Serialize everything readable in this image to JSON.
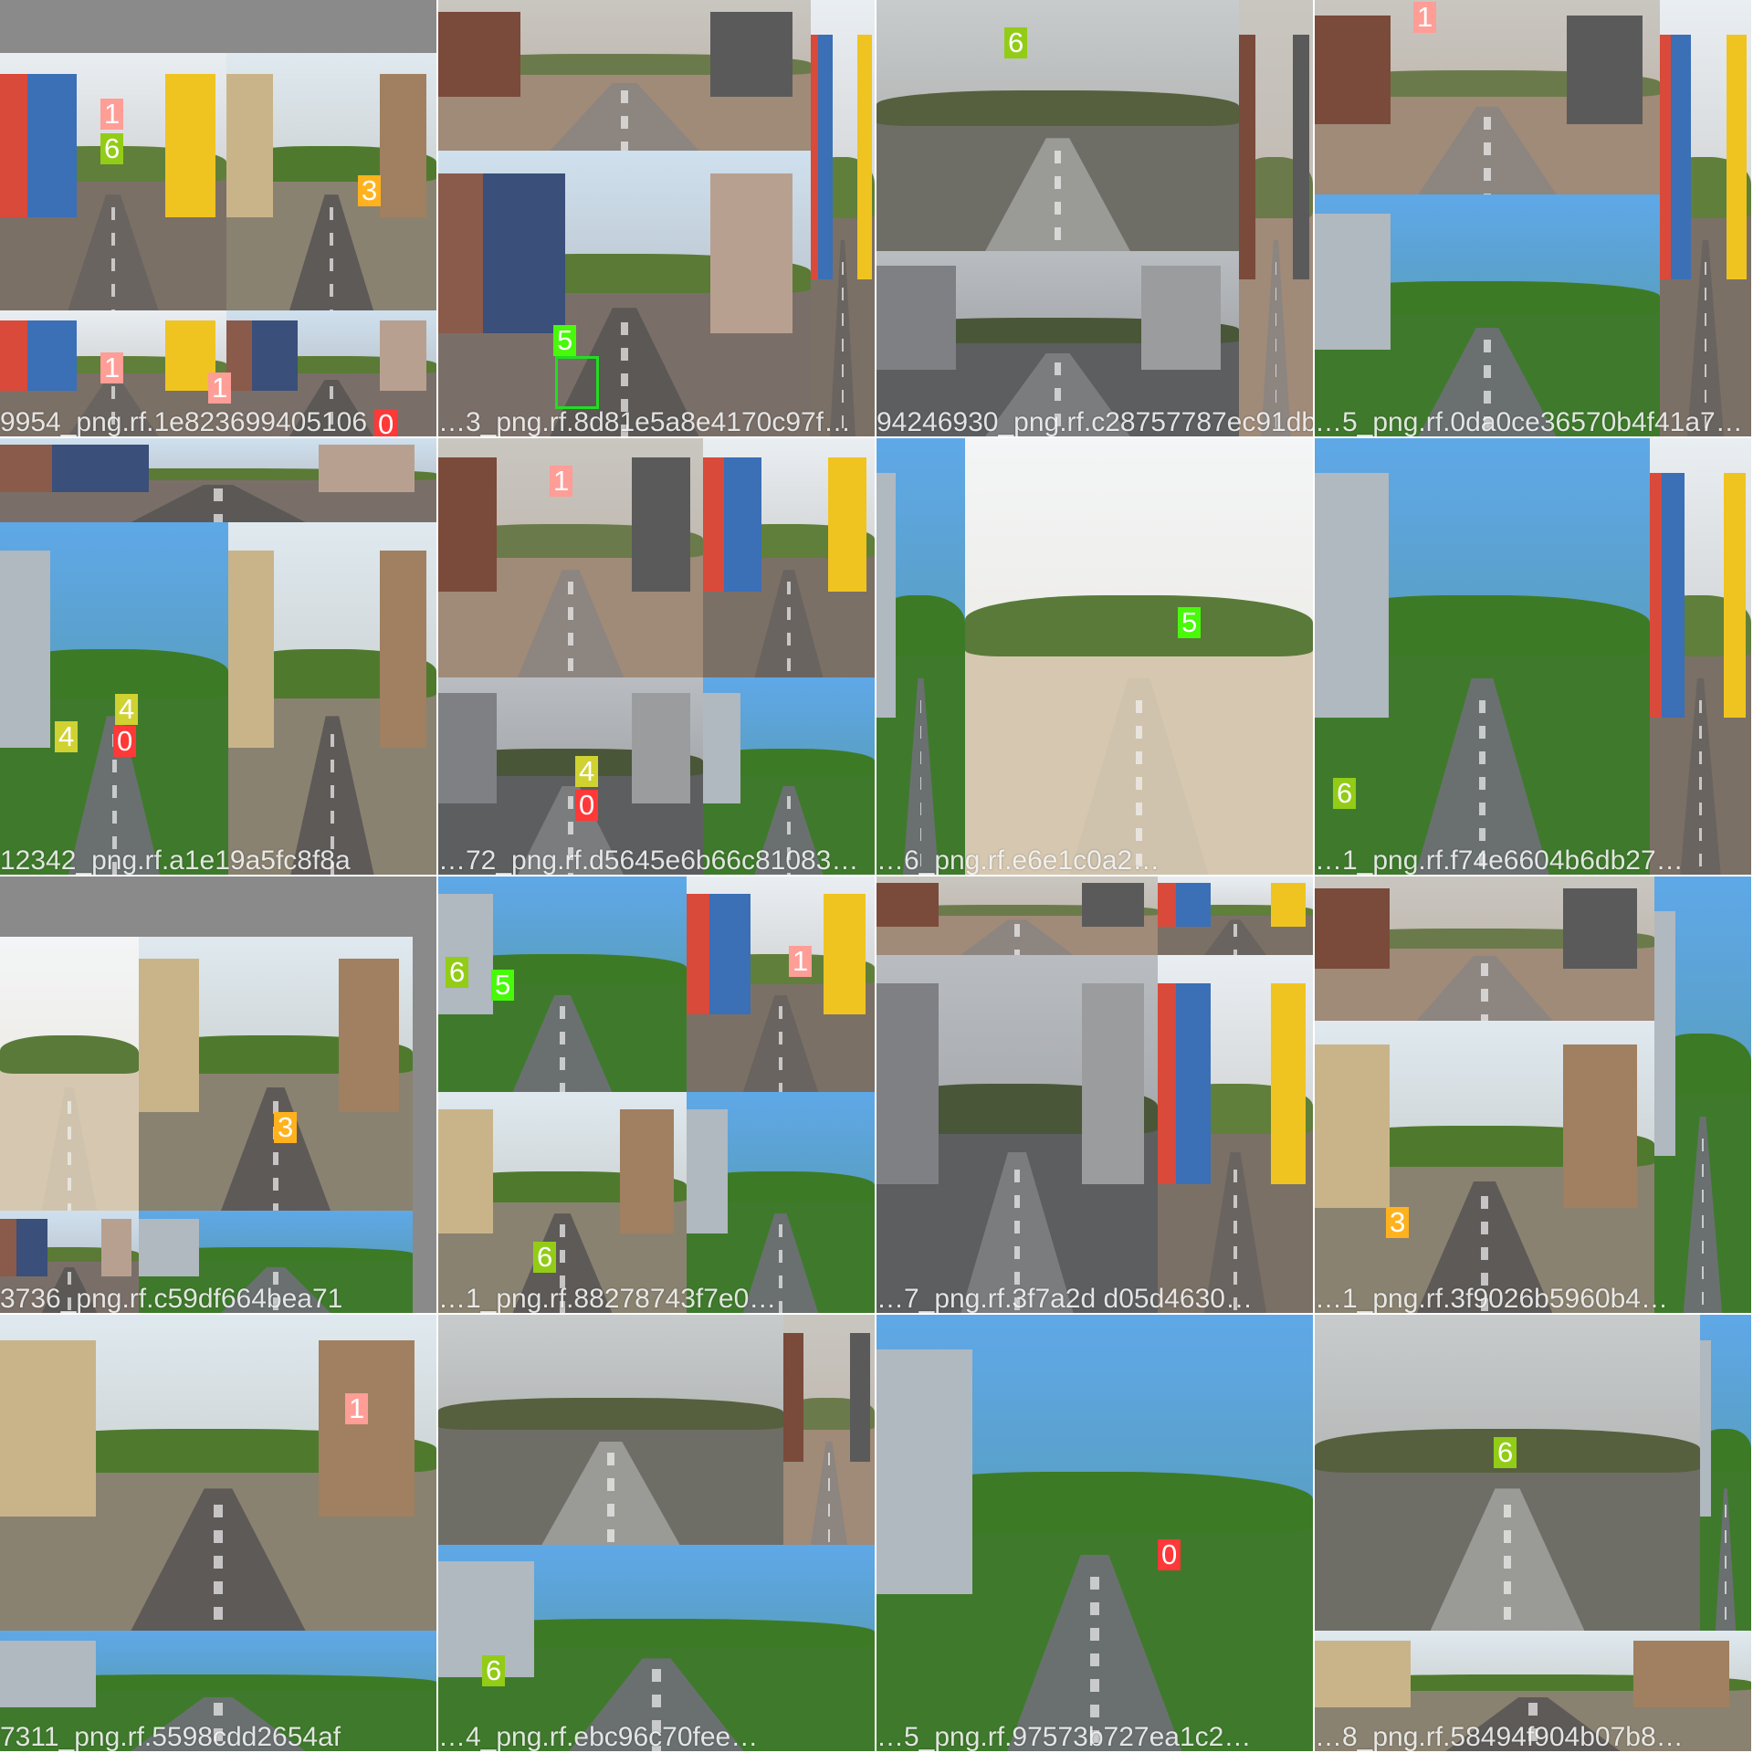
{
  "class_colors": {
    "0": "#ff3838",
    "1": "#ff9d97",
    "3": "#ffb21d",
    "4": "#cfd231",
    "5": "#48f90a",
    "6": "#92cc17"
  },
  "cells": [
    {
      "caption": "9954_png.rf.1e823699405106",
      "tiles": [
        {
          "scene": "street-shops"
        },
        {
          "scene": "street-trees"
        },
        {
          "scene": "street-shops"
        },
        {
          "scene": "street-city"
        }
      ],
      "labels": [
        "1",
        "6",
        "3",
        "1",
        "1",
        "0"
      ]
    },
    {
      "caption": "…3_png.rf.8d81e5a8e4170c97f…",
      "tiles": [
        {
          "scene": "street-motorbikes"
        },
        {
          "scene": "street-city"
        },
        {
          "scene": "street-shops"
        }
      ],
      "labels": [
        "5"
      ]
    },
    {
      "caption": "94246930_png.rf.c28757787ec91db…",
      "tiles": [
        {
          "scene": "highway"
        },
        {
          "scene": "overpass"
        },
        {
          "scene": "street-motorbikes"
        }
      ],
      "labels": [
        "6"
      ]
    },
    {
      "caption": "…5_png.rf.0da0ce36570b4f41a7…",
      "tiles": [
        {
          "scene": "street-motorbikes"
        },
        {
          "scene": "sky-trees"
        },
        {
          "scene": "street-shops"
        }
      ],
      "labels": [
        "1"
      ]
    },
    {
      "caption": "12342_png.rf.a1e19a5fc8f8a",
      "tiles": [
        {
          "scene": "street-city"
        },
        {
          "scene": "sky-trees"
        },
        {
          "scene": "street-trees"
        }
      ],
      "labels": [
        "4",
        "4",
        "0"
      ]
    },
    {
      "caption": "…72_png.rf.d5645e6b66c81083…",
      "tiles": [
        {
          "scene": "street-motorbikes"
        },
        {
          "scene": "street-shops"
        },
        {
          "scene": "overpass"
        },
        {
          "scene": "sky-trees"
        }
      ],
      "labels": [
        "1",
        "4",
        "0"
      ]
    },
    {
      "caption": "…6_png.rf.e6e1c0a2…",
      "tiles": [
        {
          "scene": "sky-trees"
        },
        {
          "scene": "open-road"
        }
      ],
      "labels": [
        "5"
      ]
    },
    {
      "caption": "…1_png.rf.f74e6604b6db27…",
      "tiles": [
        {
          "scene": "sky-trees"
        },
        {
          "scene": "street-shops"
        }
      ],
      "labels": [
        "6"
      ]
    },
    {
      "caption": "3736_png.rf.c59df664bea71",
      "tiles": [
        {
          "scene": "open-road"
        },
        {
          "scene": "street-trees"
        },
        {
          "scene": "street-city"
        },
        {
          "scene": "sky-trees"
        }
      ],
      "labels": [
        "3"
      ]
    },
    {
      "caption": "…1_png.rf.88278743f7e0…",
      "tiles": [
        {
          "scene": "sky-trees"
        },
        {
          "scene": "street-shops"
        },
        {
          "scene": "street-trees"
        },
        {
          "scene": "sky-trees"
        }
      ],
      "labels": [
        "6",
        "5",
        "1",
        "6"
      ]
    },
    {
      "caption": "…7_png.rf.3f7a2d d05d4630…",
      "tiles": [
        {
          "scene": "street-motorbikes"
        },
        {
          "scene": "street-shops"
        },
        {
          "scene": "overpass"
        },
        {
          "scene": "street-shops"
        }
      ],
      "labels": []
    },
    {
      "caption": "…1_png.rf.3f9026b5960b4…",
      "tiles": [
        {
          "scene": "street-motorbikes"
        },
        {
          "scene": "street-trees"
        },
        {
          "scene": "sky-trees"
        }
      ],
      "labels": [
        "3"
      ]
    },
    {
      "caption": "7311_png.rf.5598cdd2654af",
      "tiles": [
        {
          "scene": "street-trees"
        },
        {
          "scene": "sky-trees"
        }
      ],
      "labels": [
        "1"
      ]
    },
    {
      "caption": "…4_png.rf.ebc96c70fee…",
      "tiles": [
        {
          "scene": "highway"
        },
        {
          "scene": "street-motorbikes"
        },
        {
          "scene": "sky-trees"
        }
      ],
      "labels": [
        "6"
      ]
    },
    {
      "caption": "…5_png.rf.97573b727ea1c2…",
      "tiles": [
        {
          "scene": "sky-trees"
        }
      ],
      "labels": [
        "0"
      ]
    },
    {
      "caption": "…8_png.rf.58494f904b07b8…",
      "tiles": [
        {
          "scene": "highway"
        },
        {
          "scene": "street-trees"
        },
        {
          "scene": "sky-trees"
        }
      ],
      "labels": [
        "6"
      ]
    }
  ]
}
